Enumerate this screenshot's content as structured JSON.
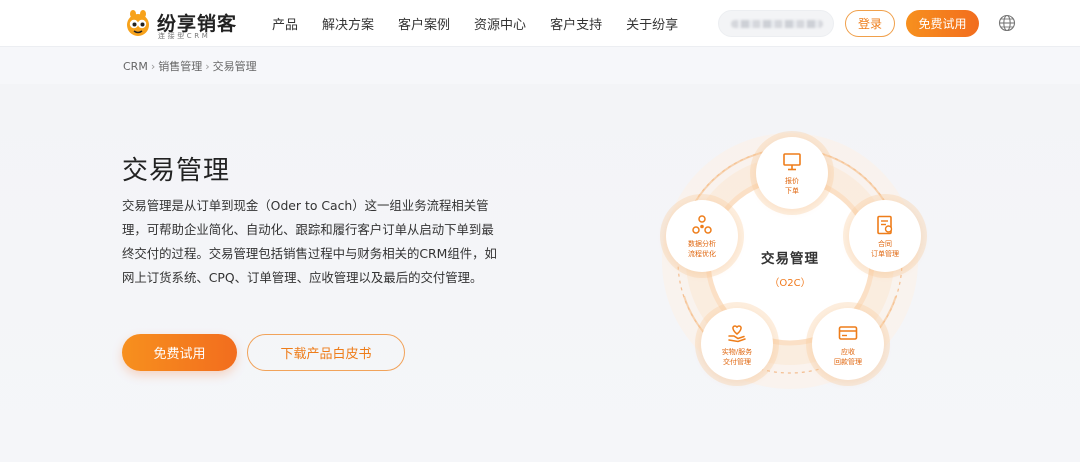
{
  "header": {
    "logo": {
      "name": "纷享销客",
      "tagline": "连接型CRM"
    },
    "nav": [
      "产品",
      "解决方案",
      "客户案例",
      "资源中心",
      "客户支持",
      "关于纷享"
    ],
    "login_label": "登录",
    "trial_label": "免费试用"
  },
  "breadcrumb": [
    "CRM",
    "销售管理",
    "交易管理"
  ],
  "hero": {
    "title": "交易管理",
    "description": "交易管理是从订单到现金（Oder to Cach）这一组业务流程相关管理，可帮助企业简化、自动化、跟踪和履行客户订单从启动下单到最终交付的过程。交易管理包括销售过程中与财务相关的CRM组件，如网上订货系统、CPQ、订单管理、应收管理以及最后的交付管理。",
    "trial_button": "免费试用",
    "whitepaper_button": "下载产品白皮书"
  },
  "diagram": {
    "center_title": "交易管理",
    "center_sub": "（O2C）",
    "nodes": [
      {
        "line1": "报价",
        "line2": "下单",
        "icon": "monitor-icon"
      },
      {
        "line1": "合同",
        "line2": "订单管理",
        "icon": "contract-icon"
      },
      {
        "line1": "应收",
        "line2": "回款管理",
        "icon": "payment-card-icon"
      },
      {
        "line1": "实物/服务",
        "line2": "交付管理",
        "icon": "heart-hand-icon"
      },
      {
        "line1": "数据分析",
        "line2": "流程优化",
        "icon": "data-network-icon"
      }
    ]
  },
  "colors": {
    "accent": "#f26d1e",
    "accent_light": "#f7901e"
  }
}
